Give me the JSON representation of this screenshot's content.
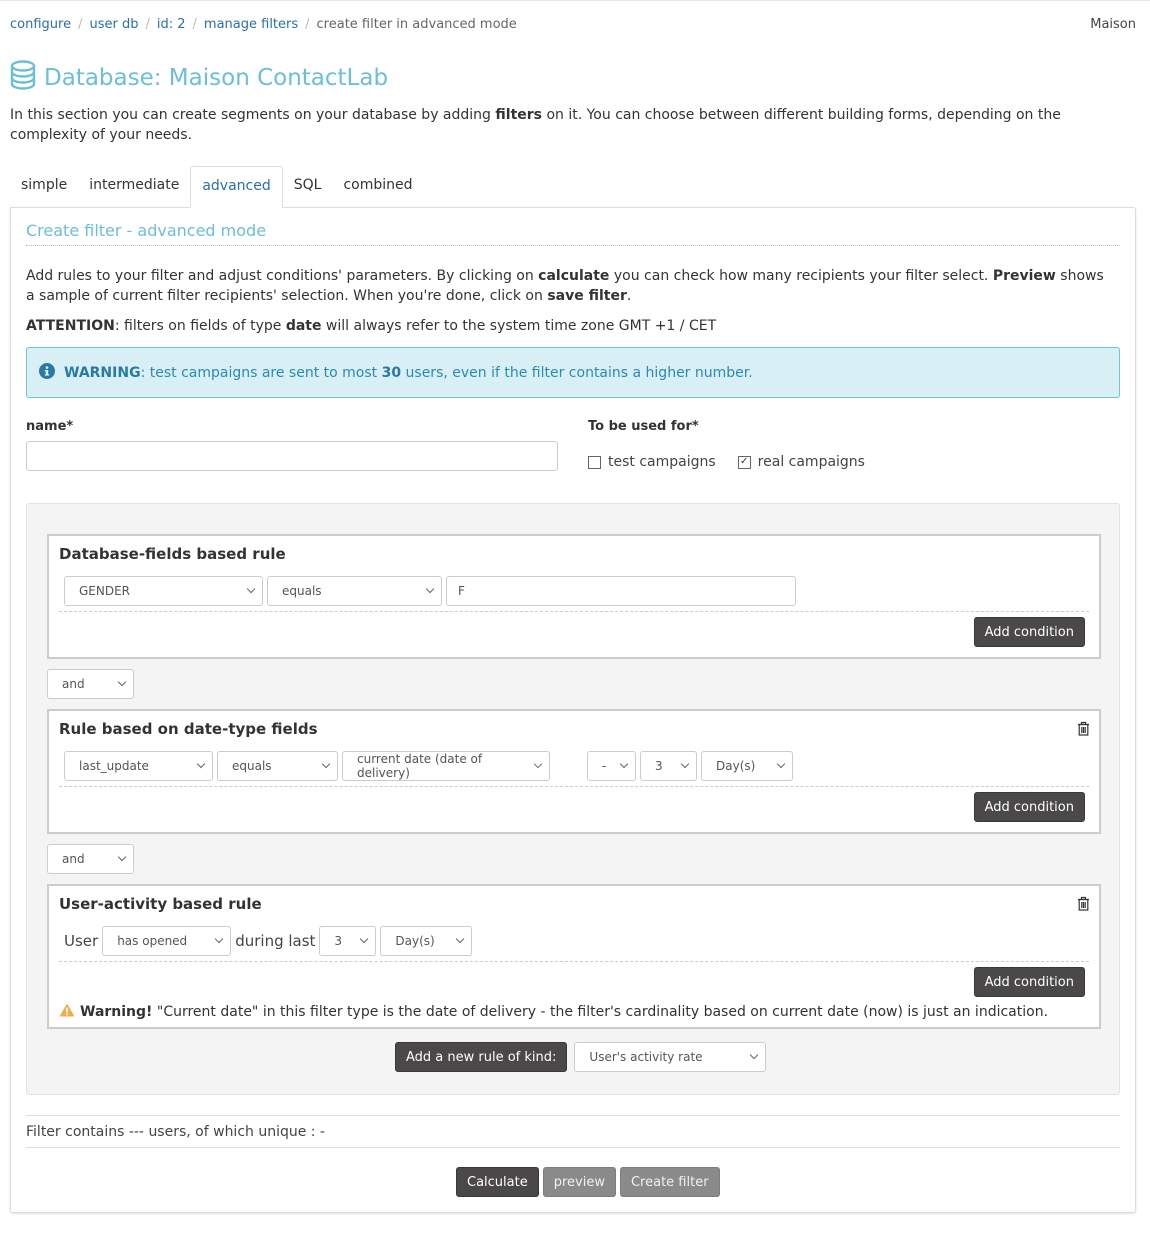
{
  "breadcrumb": {
    "items": [
      {
        "label": "configure",
        "link": true
      },
      {
        "label": "user db",
        "link": true
      },
      {
        "label": "id: 2",
        "link": true
      },
      {
        "label": "manage filters",
        "link": true
      },
      {
        "label": "create filter in advanced mode",
        "link": false
      }
    ],
    "separator": "/"
  },
  "user": {
    "name": "Maison"
  },
  "header": {
    "title": "Database: Maison ContactLab",
    "icon": "database-icon"
  },
  "intro": {
    "before": "In this section you can create segments on your database by adding ",
    "bold": "filters",
    "after": " on it. You can choose between different building forms, depending on the complexity of your needs."
  },
  "tabs": [
    {
      "label": "simple",
      "active": false
    },
    {
      "label": "intermediate",
      "active": false
    },
    {
      "label": "advanced",
      "active": true
    },
    {
      "label": "SQL",
      "active": false
    },
    {
      "label": "combined",
      "active": false
    }
  ],
  "panel": {
    "heading": "Create filter - advanced mode",
    "desc": {
      "p1": "Add rules to your filter and adjust conditions' parameters. By clicking on ",
      "b1": "calculate",
      "p2": " you can check how many recipients your filter select. ",
      "b2": "Preview",
      "p3": " shows a sample of current filter recipients' selection. When you're done, click on ",
      "b3": "save filter",
      "p4": "."
    },
    "attention": {
      "b1": "ATTENTION",
      "p1": ": filters on fields of type ",
      "b2": "date",
      "p2": " will always refer to the system time zone GMT +1 / CET"
    },
    "alert": {
      "b1": "WARNING",
      "p1": ": test campaigns are sent to most ",
      "b2": "30",
      "p2": " users, even if the filter contains a higher number."
    },
    "name_label": "name*",
    "name_value": "",
    "used_for_label": "To be used for*",
    "checkboxes": [
      {
        "label": "test campaigns",
        "checked": false
      },
      {
        "label": "real campaigns",
        "checked": true
      }
    ]
  },
  "rules": [
    {
      "title": "Database-fields based rule",
      "field": "GENDER",
      "operator": "equals",
      "value": "F",
      "add_condition": "Add condition"
    },
    {
      "title": "Rule based on date-type fields",
      "field": "last_update",
      "operator": "equals",
      "reference": "current date (date of delivery)",
      "sign": "-",
      "amount": "3",
      "unit": "Day(s)",
      "add_condition": "Add condition"
    },
    {
      "title": "User-activity based rule",
      "prefix": "User",
      "action": "has opened",
      "middle": "during last",
      "amount": "3",
      "unit": "Day(s)",
      "add_condition": "Add condition",
      "warning_bold": "Warning!",
      "warning_text": " \"Current date\" in this filter type is the date of delivery - the filter's cardinality based on current date (now) is just an indication."
    }
  ],
  "conjunctions": [
    "and",
    "and"
  ],
  "add_rule": {
    "button": "Add a new rule of kind:",
    "selected": "User's activity rate"
  },
  "count_text": "Filter contains --- users, of which unique : -",
  "actions": {
    "calculate": "Calculate",
    "preview": "preview",
    "create": "Create filter"
  }
}
